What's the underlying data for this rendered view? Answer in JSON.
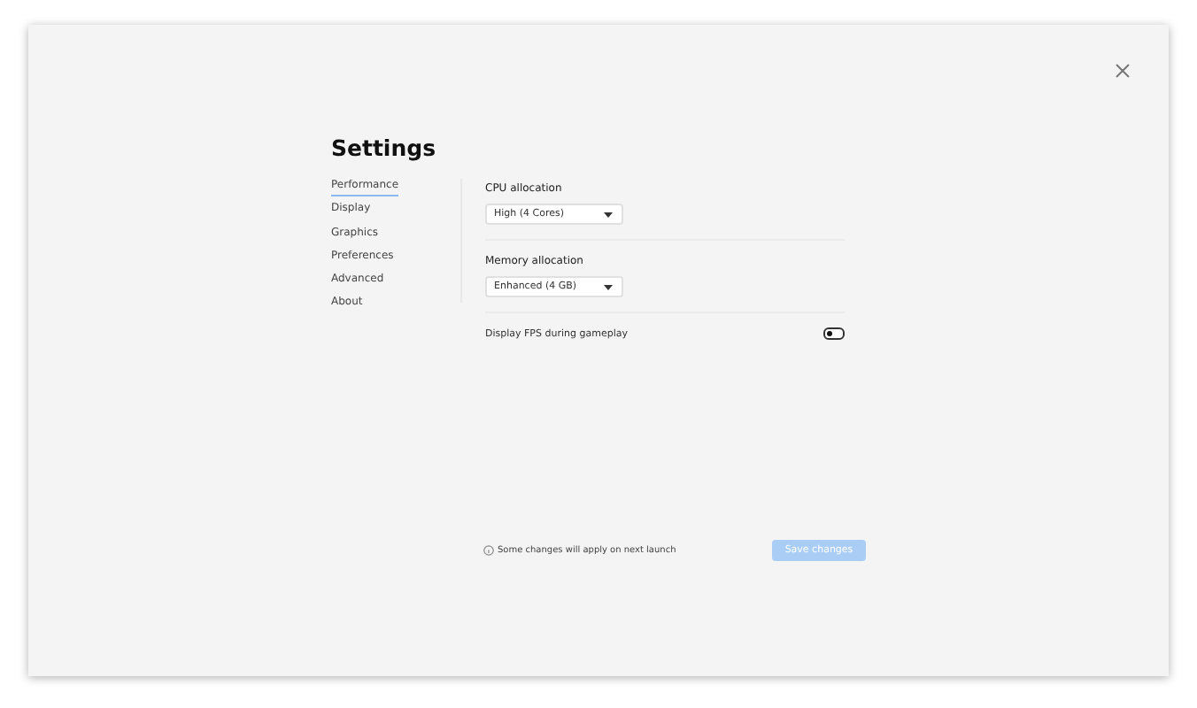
{
  "title": "Settings",
  "nav": [
    {
      "label": "Performance",
      "selected": true
    },
    {
      "label": "Display",
      "selected": false
    },
    {
      "label": "Graphics",
      "selected": false
    },
    {
      "label": "Preferences",
      "selected": false
    },
    {
      "label": "Advanced",
      "selected": false
    },
    {
      "label": "About",
      "selected": false
    }
  ],
  "settings": [
    {
      "kind": "select",
      "label": "CPU allocation",
      "value": "High (4 Cores)"
    },
    {
      "kind": "select",
      "label": "Memory allocation",
      "value": "Enhanced (4 GB)"
    },
    {
      "kind": "toggle",
      "label": "Display FPS during gameplay",
      "on": false
    }
  ],
  "footer": {
    "note": "Some changes will apply on next launch",
    "button": {
      "label": "Save changes",
      "disabled": true
    }
  }
}
